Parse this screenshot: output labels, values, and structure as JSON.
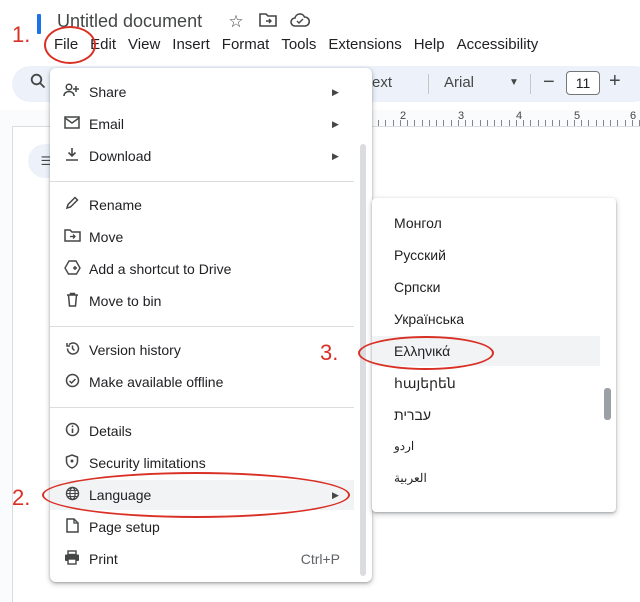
{
  "header": {
    "title": "Untitled document",
    "icons": [
      "star-icon",
      "move-to-folder-icon",
      "cloud-saved-icon"
    ]
  },
  "menubar": [
    "File",
    "Edit",
    "View",
    "Insert",
    "Format",
    "Tools",
    "Extensions",
    "Help",
    "Accessibility"
  ],
  "toolbar": {
    "style_partial": "ext",
    "font": "Arial",
    "font_size": "11",
    "ruler_numbers": [
      "2",
      "3",
      "4",
      "5",
      "6"
    ]
  },
  "file_menu": {
    "items": [
      {
        "label": "Share",
        "icon": "person-add-icon",
        "submenu": true
      },
      {
        "label": "Email",
        "icon": "email-icon",
        "submenu": true
      },
      {
        "label": "Download",
        "icon": "download-icon",
        "submenu": true
      },
      {
        "label": "Rename",
        "icon": "pencil-icon"
      },
      {
        "label": "Move",
        "icon": "folder-move-icon"
      },
      {
        "label": "Add a shortcut to Drive",
        "icon": "drive-shortcut-icon"
      },
      {
        "label": "Move to bin",
        "icon": "trash-icon"
      },
      {
        "label": "Version history",
        "icon": "history-icon"
      },
      {
        "label": "Make available offline",
        "icon": "offline-icon"
      },
      {
        "label": "Details",
        "icon": "info-icon"
      },
      {
        "label": "Security limitations",
        "icon": "shield-icon"
      },
      {
        "label": "Language",
        "icon": "globe-icon",
        "submenu": true,
        "highlighted": true
      },
      {
        "label": "Page setup",
        "icon": "page-setup-icon"
      },
      {
        "label": "Print",
        "icon": "print-icon",
        "shortcut": "Ctrl+P"
      }
    ]
  },
  "language_menu": {
    "items": [
      "Монгол",
      "Русский",
      "Српски",
      "Українська",
      "Ελληνικά",
      "հայերեն",
      "עברית",
      "اردو",
      "العربية"
    ],
    "highlighted": "Ελληνικά"
  },
  "annotations": [
    "1.",
    "2.",
    "3."
  ],
  "colors": {
    "annotation": "#d93025",
    "toolbar_bg": "#edf2fa",
    "highlight": "#f1f3f4"
  }
}
